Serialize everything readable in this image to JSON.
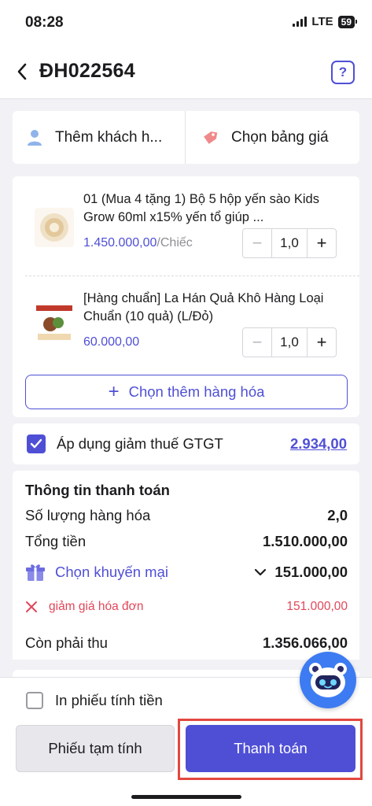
{
  "status_bar": {
    "time": "08:28",
    "network": "LTE",
    "battery": "59"
  },
  "header": {
    "order_code": "ĐH022564",
    "back_icon": "chevron-left-icon",
    "help_icon": "question-icon"
  },
  "customer_bar": {
    "add_customer_label": "Thêm khách h...",
    "price_list_label": "Chọn bảng giá"
  },
  "products": [
    {
      "name": "01 (Mua 4 tặng 1) Bộ 5 hộp yến sào Kids Grow 60ml x15% yến tổ giúp ...",
      "price": "1.450.000,00",
      "unit": "/Chiếc",
      "quantity": "1,0"
    },
    {
      "name": "[Hàng chuẩn] La Hán Quả Khô Hàng Loại Chuẩn (10 quả) (L/Đỏ)",
      "price": "60.000,00",
      "unit": "",
      "quantity": "1,0"
    }
  ],
  "add_more_label": "Chọn thêm hàng hóa",
  "vat": {
    "label": "Áp dụng giảm thuế GTGT",
    "amount": "2.934,00",
    "checked": true
  },
  "payment": {
    "title": "Thông tin thanh toán",
    "item_count_label": "Số lượng hàng hóa",
    "item_count_value": "2,0",
    "total_label": "Tổng tiền",
    "total_value": "1.510.000,00",
    "promo_label": "Chọn khuyến mại",
    "promo_value": "151.000,00",
    "discount_label": "giảm giá hóa đơn",
    "discount_value": "151.000,00",
    "remaining_label": "Còn phải thu",
    "remaining_value": "1.356.066,00"
  },
  "footer": {
    "print_label": "In phiếu tính tiền",
    "draft_button": "Phiếu tạm tính",
    "pay_button": "Thanh toán"
  },
  "colors": {
    "accent": "#4f4fd6",
    "danger": "#e0475a",
    "highlight": "#e2473f"
  }
}
